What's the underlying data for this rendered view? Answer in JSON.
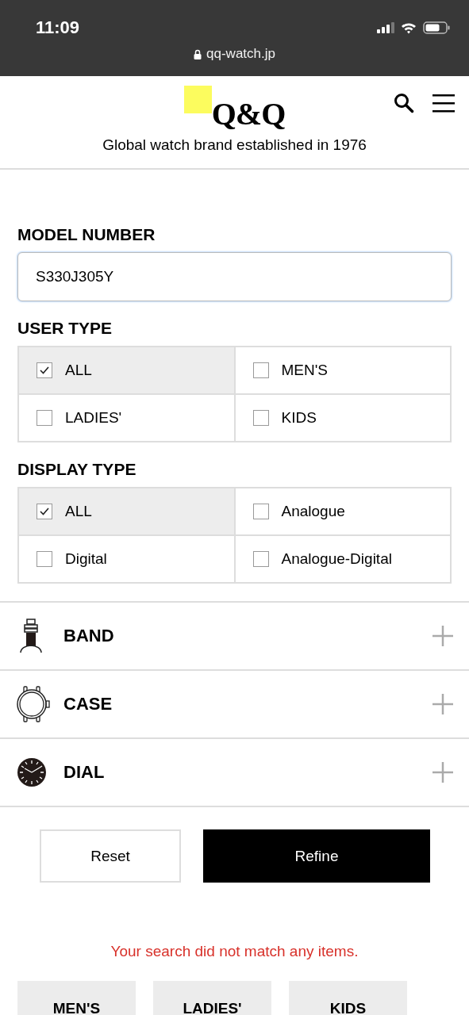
{
  "status_bar": {
    "time": "11:09",
    "url": "qq-watch.jp"
  },
  "header": {
    "logo": "Q&Q",
    "tagline": "Global watch brand established in 1976"
  },
  "model_number": {
    "label": "MODEL NUMBER",
    "value": "S330J305Y"
  },
  "filter_groups": [
    {
      "label": "USER TYPE",
      "options": [
        {
          "label": "ALL",
          "selected": true
        },
        {
          "label": "MEN'S",
          "selected": false
        },
        {
          "label": "LADIES'",
          "selected": false
        },
        {
          "label": "KIDS",
          "selected": false
        }
      ]
    },
    {
      "label": "DISPLAY TYPE",
      "options": [
        {
          "label": "ALL",
          "selected": true
        },
        {
          "label": "Analogue",
          "selected": false
        },
        {
          "label": "Digital",
          "selected": false
        },
        {
          "label": "Analogue-Digital",
          "selected": false
        }
      ]
    }
  ],
  "accordions": [
    {
      "kind": "band",
      "label": "BAND",
      "expanded": false
    },
    {
      "kind": "case",
      "label": "CASE",
      "expanded": false
    },
    {
      "kind": "dial",
      "label": "DIAL",
      "expanded": false
    }
  ],
  "buttons": [
    {
      "kind": "secondary",
      "label": "Reset"
    },
    {
      "kind": "primary",
      "label": "Refine"
    }
  ],
  "message": "Your search did not match any items.",
  "category_tabs": [
    {
      "label": "MEN'S"
    },
    {
      "label": "LADIES'"
    },
    {
      "label": "KIDS"
    }
  ]
}
